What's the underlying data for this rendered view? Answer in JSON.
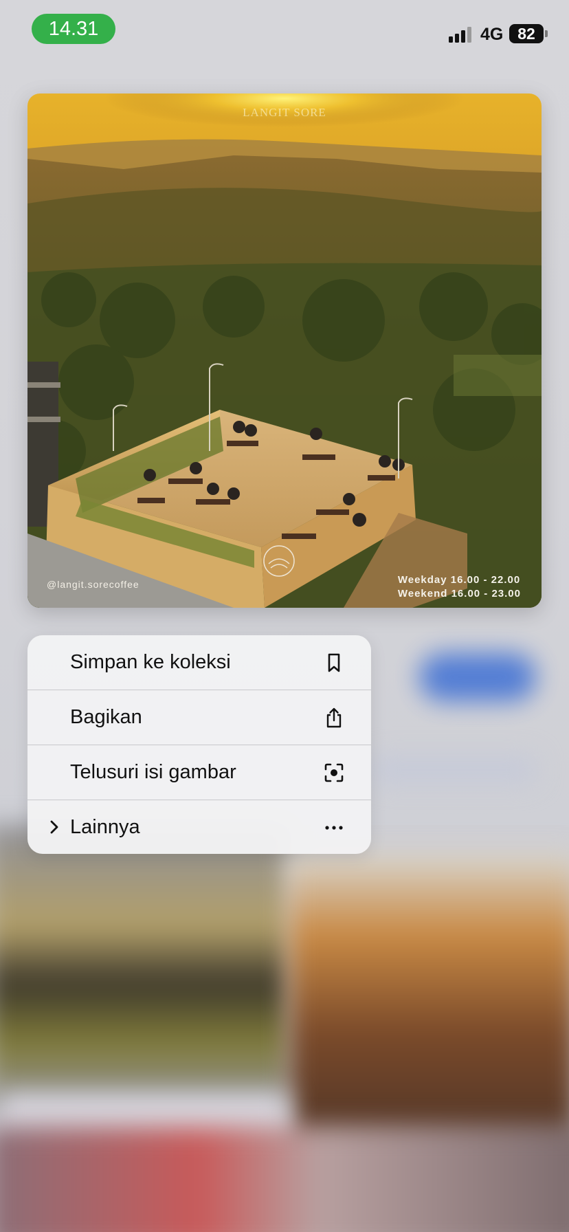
{
  "status_bar": {
    "time": "14.31",
    "network": "4G",
    "battery": "82",
    "time_pill_color": "#34b04a"
  },
  "preview": {
    "brand_text": "LANGIT SORE",
    "instagram_handle": "@langit.sorecoffee",
    "hours_weekday": "Weekday 16.00 - 22.00",
    "hours_weekend": "Weekend 16.00 - 23.00"
  },
  "context_menu": {
    "items": [
      {
        "label": "Simpan ke koleksi",
        "icon": "bookmark-icon"
      },
      {
        "label": "Bagikan",
        "icon": "share-icon"
      },
      {
        "label": "Telusuri isi gambar",
        "icon": "visual-search-icon"
      },
      {
        "label": "Lainnya",
        "icon": "more-icon",
        "has_submenu": true
      }
    ]
  }
}
